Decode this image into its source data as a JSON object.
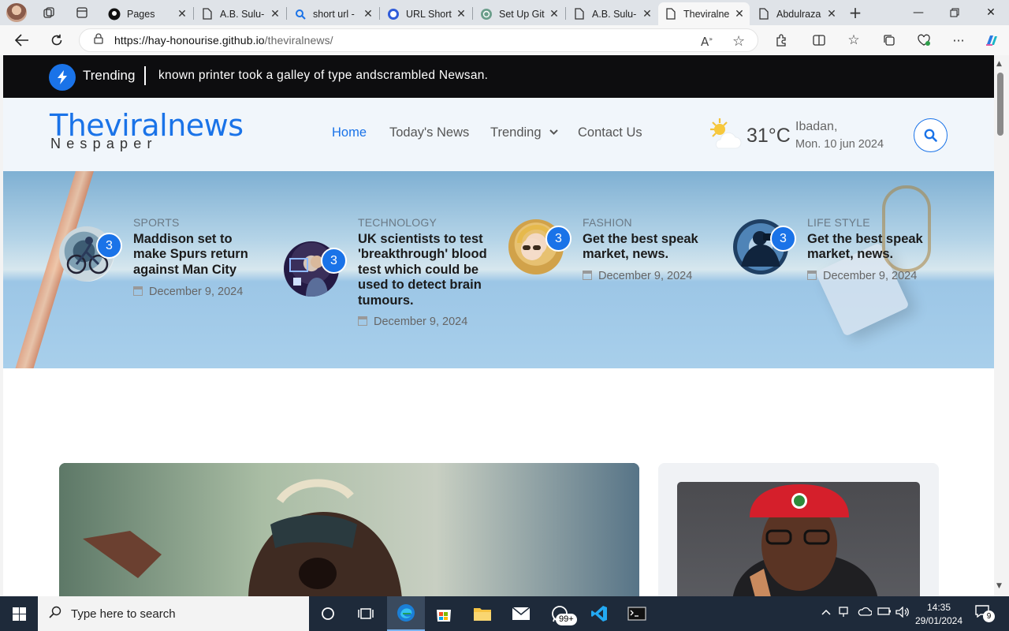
{
  "browser": {
    "tabs": [
      {
        "title": "Pages",
        "favicon": "github-icon"
      },
      {
        "title": "A.B. Sulu-",
        "favicon": "page-icon"
      },
      {
        "title": "short url -",
        "favicon": "search-icon"
      },
      {
        "title": "URL Short",
        "favicon": "circle-icon"
      },
      {
        "title": "Set Up Git",
        "favicon": "chatgpt-icon"
      },
      {
        "title": "A.B. Sulu-",
        "favicon": "page-icon"
      },
      {
        "title": "Theviralne",
        "favicon": "page-icon",
        "active": true
      },
      {
        "title": "Abdulraza",
        "favicon": "page-icon"
      }
    ],
    "url_host": "https://hay-honourise.github.io",
    "url_path": "/theviralnews/"
  },
  "page": {
    "trending": {
      "label": "Trending",
      "ticker": "known printer took a galley of type andscrambled Newsan."
    },
    "logo": {
      "main": "Theviralnews",
      "sub": "Nespaper"
    },
    "nav": [
      {
        "label": "Home",
        "active": true
      },
      {
        "label": "Today's News"
      },
      {
        "label": "Trending",
        "has_dropdown": true
      },
      {
        "label": "Contact Us"
      }
    ],
    "weather": {
      "temperature": "31°C",
      "city": "Ibadan,",
      "date": "Mon. 10 jun 2024"
    },
    "hero_stories": [
      {
        "category": "SPORTS",
        "title": "Maddison set to make Spurs return against Man City",
        "date": "December 9, 2024",
        "count": "3"
      },
      {
        "category": "TECHNOLOGY",
        "title": "UK scientists to test 'breakthrough' blood test which could be used to detect brain tumours.",
        "date": "December 9, 2024",
        "count": "3"
      },
      {
        "category": "FASHION",
        "title": "Get the best speak market, news.",
        "date": "December 9, 2024",
        "count": "3"
      },
      {
        "category": "LIFE STYLE",
        "title": "Get the best speak market, news.",
        "date": "December 9, 2024",
        "count": "3"
      }
    ],
    "accent_color": "#1a73e8"
  },
  "taskbar": {
    "search_placeholder": "Type here to search",
    "whatsapp_badge": "99+",
    "time": "14:35",
    "date": "29/01/2024",
    "notification_count": "9"
  }
}
